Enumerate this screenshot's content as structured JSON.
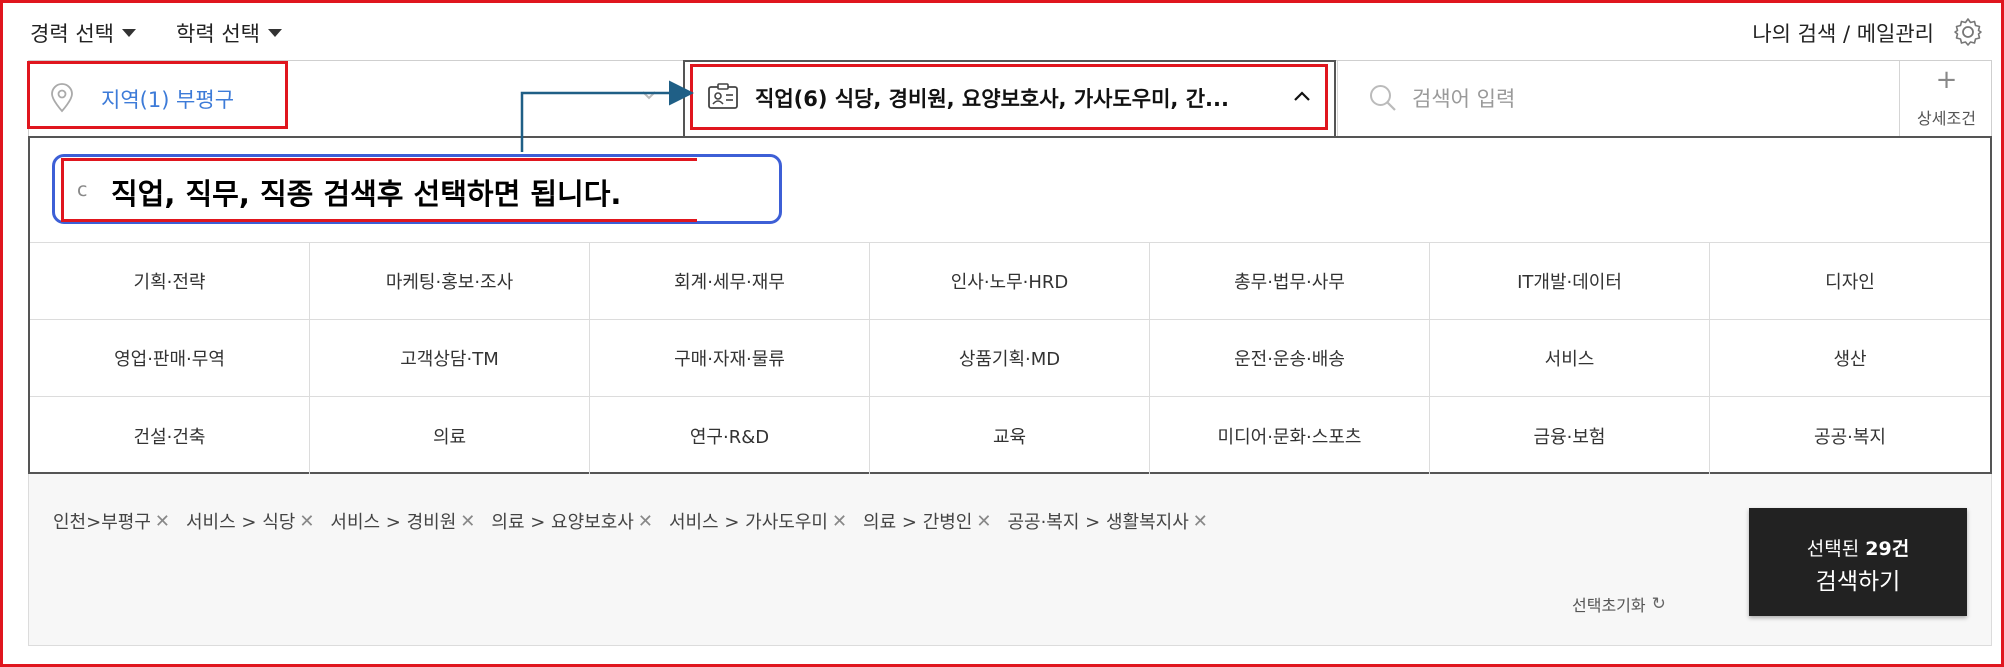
{
  "topbar": {
    "career_filter": "경력 선택",
    "education_filter": "학력 선택",
    "my_search_link": "나의 검색 / 메일관리"
  },
  "search": {
    "region": "지역(1) 부평구",
    "occupation": "직업(6) 식당, 경비원, 요양보호사, 가사도우미, 간...",
    "keyword_placeholder": "검색어 입력",
    "keyword_value": "",
    "detail_plus": "+",
    "detail_label": "상세조건"
  },
  "occupation_search": {
    "input_stub": "c",
    "annotation": "직업, 직무, 직종 검색후 선택하면 됩니다."
  },
  "categories": [
    [
      "기획·전략",
      "마케팅·홍보·조사",
      "회계·세무·재무",
      "인사·노무·HRD",
      "총무·법무·사무",
      "IT개발·데이터",
      "디자인"
    ],
    [
      "영업·판매·무역",
      "고객상담·TM",
      "구매·자재·물류",
      "상품기획·MD",
      "운전·운송·배송",
      "서비스",
      "생산"
    ],
    [
      "건설·건축",
      "의료",
      "연구·R&D",
      "교육",
      "미디어·문화·스포츠",
      "금융·보험",
      "공공·복지"
    ]
  ],
  "selected_chips": [
    "인천>부평구",
    "서비스 > 식당",
    "서비스 > 경비원",
    "의료 > 요양보호사",
    "서비스 > 가사도우미",
    "의료 > 간병인",
    "공공·복지 > 생활복지사"
  ],
  "chip_remove_glyph": "✕",
  "reset": {
    "label": "선택초기화",
    "icon": "↻"
  },
  "search_button": {
    "prefix": "선택된 ",
    "count": "29건",
    "label": "검색하기"
  },
  "colors": {
    "highlight": "#e0161e",
    "region_text": "#3d7bd8",
    "occ_search_border": "#3d5fd6",
    "annotation_arrow": "#1f5f86",
    "search_button_bg": "#222222"
  }
}
